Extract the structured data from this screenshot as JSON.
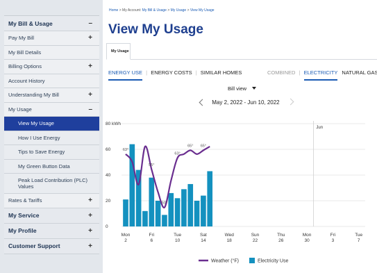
{
  "sidebar": {
    "items": [
      {
        "label": "My Bill & Usage",
        "type": "head",
        "sign": "–"
      },
      {
        "label": "Pay My Bill",
        "type": "item",
        "sign": "+"
      },
      {
        "label": "My Bill Details",
        "type": "item",
        "sign": ""
      },
      {
        "label": "Billing Options",
        "type": "item",
        "sign": "+"
      },
      {
        "label": "Account History",
        "type": "item",
        "sign": ""
      },
      {
        "label": "Understanding My Bill",
        "type": "item",
        "sign": "+"
      },
      {
        "label": "My Usage",
        "type": "item",
        "sign": "–"
      },
      {
        "label": "View My Usage",
        "type": "sub",
        "sign": "",
        "active": true
      },
      {
        "label": "How I Use Energy",
        "type": "sub",
        "sign": ""
      },
      {
        "label": "Tips to Save Energy",
        "type": "sub",
        "sign": ""
      },
      {
        "label": "My Green Button Data",
        "type": "sub",
        "sign": ""
      },
      {
        "label": "Peak Load Contribution (PLC) Values",
        "type": "sub",
        "sign": "",
        "tall": true
      },
      {
        "label": "Rates & Tariffs",
        "type": "item",
        "sign": "+"
      },
      {
        "label": "My Service",
        "type": "head",
        "sign": "+"
      },
      {
        "label": "My Profile",
        "type": "head",
        "sign": "+"
      },
      {
        "label": "Customer Support",
        "type": "head",
        "sign": "+"
      }
    ]
  },
  "breadcrumb": {
    "home": "Home",
    "account_prefix": "My Account:",
    "bill_usage": "My Bill & Usage",
    "usage": "My Usage",
    "current": "View My Usage",
    "sep": ">"
  },
  "page": {
    "title": "View My Usage",
    "tab": "My Usage"
  },
  "subnav": {
    "left": [
      "ENERGY USE",
      "ENERGY COSTS",
      "SIMILAR HOMES"
    ],
    "right": [
      "COMBINED",
      "ELECTRICITY",
      "NATURAL GAS"
    ],
    "sep": "|"
  },
  "view_select": {
    "value": "Bill view"
  },
  "date_range": "May 2, 2022 - Jun 10, 2022",
  "colors": {
    "bar": "#1491bf",
    "weather": "#6a2e8f",
    "grid": "#e3e3e3",
    "accent": "#1f3f9d"
  },
  "chart_data": {
    "type": "bar",
    "ylabel": "kWh",
    "ylim": [
      0,
      80
    ],
    "yticks": [
      0,
      20,
      40,
      60,
      80
    ],
    "xlim": [
      2,
      39
    ],
    "xticks": [
      {
        "x": 2,
        "top": "Mon",
        "bottom": "2"
      },
      {
        "x": 6,
        "top": "Fri",
        "bottom": "6"
      },
      {
        "x": 10,
        "top": "Tue",
        "bottom": "10"
      },
      {
        "x": 14,
        "top": "Sat",
        "bottom": "14"
      },
      {
        "x": 18,
        "top": "Wed",
        "bottom": "18"
      },
      {
        "x": 22,
        "top": "Sun",
        "bottom": "22"
      },
      {
        "x": 26,
        "top": "Thu",
        "bottom": "26"
      },
      {
        "x": 30,
        "top": "Mon",
        "bottom": "30"
      },
      {
        "x": 34,
        "top": "Fri",
        "bottom": "3"
      },
      {
        "x": 38,
        "top": "Tue",
        "bottom": "7"
      }
    ],
    "month_marker": {
      "x": 31,
      "label": "Jun"
    },
    "series": [
      {
        "name": "Electricity Use",
        "x": [
          2,
          3,
          4,
          5,
          6,
          7,
          8,
          9,
          10,
          11,
          12,
          13,
          14,
          15
        ],
        "values": [
          21,
          64,
          44,
          12,
          38,
          20,
          9,
          26,
          22,
          29,
          33,
          20,
          24,
          43
        ]
      },
      {
        "name": "Weather (°F)",
        "x": [
          2,
          3,
          4,
          5,
          6,
          7,
          8,
          9,
          10,
          11,
          12,
          13,
          14,
          15
        ],
        "values": [
          64,
          62,
          56,
          66,
          60,
          54,
          50,
          57,
          63,
          64,
          65,
          64,
          65,
          66
        ]
      }
    ],
    "annotations": [
      {
        "x": 2,
        "label": "63°"
      },
      {
        "x": 6,
        "label": "55°"
      },
      {
        "x": 8,
        "label": "50°"
      },
      {
        "x": 10,
        "label": "63°"
      },
      {
        "x": 12,
        "label": "65°"
      },
      {
        "x": 14,
        "label": "65°"
      }
    ],
    "legend": [
      "Weather (°F)",
      "Electricity Use"
    ]
  }
}
